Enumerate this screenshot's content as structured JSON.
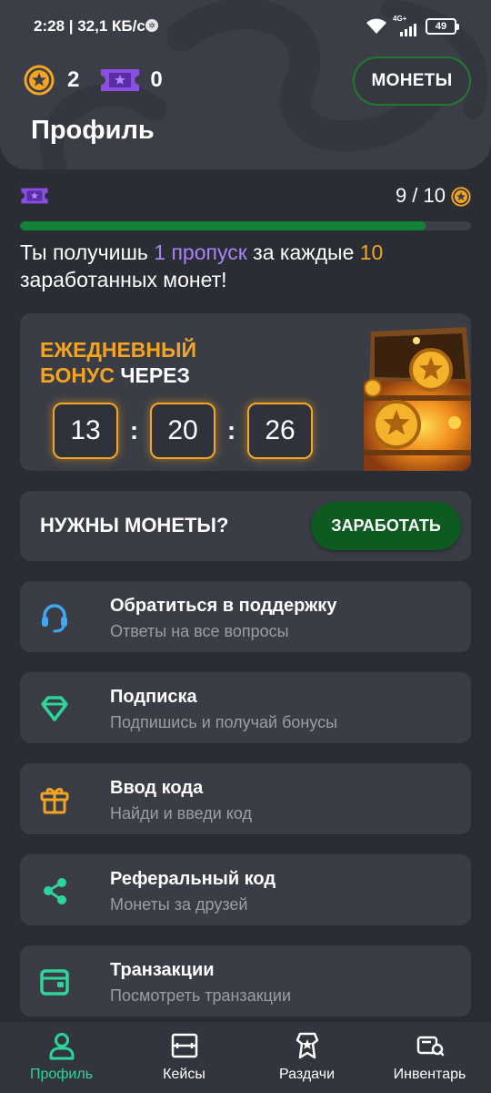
{
  "status_bar": {
    "time": "2:28 | 32,1 КБ/с",
    "network": "4G+",
    "battery": "49"
  },
  "header": {
    "coin_balance": "2",
    "ticket_balance": "0",
    "coins_button": "МОНЕТЫ",
    "title": "Профиль"
  },
  "pass": {
    "progress_text": "9 / 10",
    "progress_fraction": 0.9,
    "info": {
      "part1": "Ты получишь ",
      "highlight1": "1 пропуск",
      "part2": " за каждые ",
      "highlight2": "10",
      "part3": " заработанных монет!"
    }
  },
  "daily_bonus": {
    "title_highlight": "ЕЖЕДНЕВНЫЙ БОНУС",
    "title_rest": " ЧЕРЕЗ",
    "hours": "13",
    "minutes": "20",
    "seconds": "26",
    "separator": ":"
  },
  "need_coins": {
    "title": "НУЖНЫ МОНЕТЫ?",
    "button": "ЗАРАБОТАТЬ"
  },
  "menu": [
    {
      "title": "Обратиться в поддержку",
      "subtitle": "Ответы на все вопросы",
      "icon": "headset-icon"
    },
    {
      "title": "Подписка",
      "subtitle": "Подпишись и получай бонусы",
      "icon": "diamond-icon"
    },
    {
      "title": "Ввод кода",
      "subtitle": "Найди и введи код",
      "icon": "gift-icon"
    },
    {
      "title": "Реферальный код",
      "subtitle": "Монеты за друзей",
      "icon": "share-icon"
    },
    {
      "title": "Транзакции",
      "subtitle": "Посмотреть транзакции",
      "icon": "wallet-icon"
    }
  ],
  "colors": {
    "accent_green": "#2ed59a",
    "coin_orange": "#f4a423",
    "ticket_purple": "#8a4fe0",
    "background": "#2a2d34"
  },
  "nav": [
    {
      "label": "Профиль",
      "active": true
    },
    {
      "label": "Кейсы"
    },
    {
      "label": "Раздачи"
    },
    {
      "label": "Инвентарь"
    }
  ]
}
